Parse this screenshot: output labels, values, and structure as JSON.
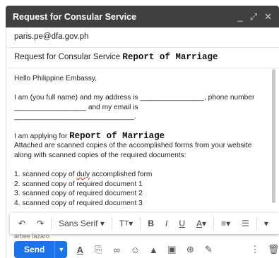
{
  "window": {
    "title": "Request for Consular Service",
    "controls": [
      "_",
      "⤢",
      "✕"
    ]
  },
  "to": "paris.pe@dfa.gov.ph",
  "subject": {
    "text": "Request for Consular Service",
    "highlight": "Report of Marriage"
  },
  "body": {
    "greeting": "Hello Philippine Embassy,",
    "line1": "I am (you full name) and my address is ________________, phone number",
    "line2": "__________________ and my email is ______________________________.",
    "applying_prefix": "I am applying for",
    "applying_service": "Report of Marriage",
    "attached1": "Attached are scanned copies of the accomplished forms from your website",
    "attached2": "along with scanned copies of the required documents:",
    "items": [
      {
        "pre": "1. scanned copy of ",
        "err": "duly",
        "post": " accomplished form"
      },
      {
        "pre": "2. scanned copy of required document 1",
        "err": "",
        "post": ""
      },
      {
        "pre": "3. scanned copy of required document 2",
        "err": "",
        "post": ""
      },
      {
        "pre": "4. scanned copy of required document 3",
        "err": "",
        "post": ""
      }
    ]
  },
  "toolbar": {
    "font": "Sans Serif",
    "labels": [
      "B",
      "I",
      "U",
      "A"
    ]
  },
  "signature": "arbee lazaro",
  "send": {
    "label": "Send"
  }
}
